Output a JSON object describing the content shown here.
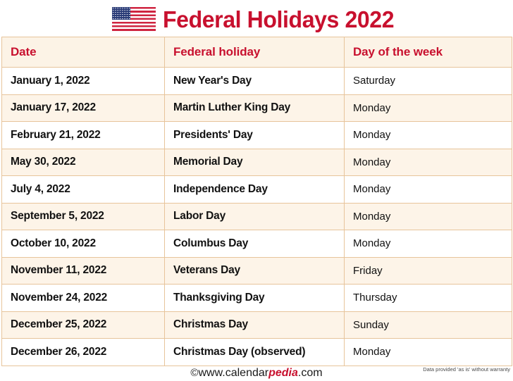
{
  "header": {
    "flag_icon": "us-flag-icon",
    "title": "Federal Holidays 2022"
  },
  "table": {
    "columns": [
      "Date",
      "Federal holiday",
      "Day of the week"
    ],
    "rows": [
      {
        "date": "January 1, 2022",
        "holiday": "New Year's Day",
        "day": "Saturday"
      },
      {
        "date": "January 17, 2022",
        "holiday": "Martin Luther King Day",
        "day": "Monday"
      },
      {
        "date": "February 21, 2022",
        "holiday": "Presidents' Day",
        "day": "Monday"
      },
      {
        "date": "May 30, 2022",
        "holiday": "Memorial Day",
        "day": "Monday"
      },
      {
        "date": "July 4, 2022",
        "holiday": "Independence Day",
        "day": "Monday"
      },
      {
        "date": "September 5, 2022",
        "holiday": "Labor Day",
        "day": "Monday"
      },
      {
        "date": "October 10, 2022",
        "holiday": "Columbus Day",
        "day": "Monday"
      },
      {
        "date": "November 11, 2022",
        "holiday": "Veterans Day",
        "day": "Friday"
      },
      {
        "date": "November 24, 2022",
        "holiday": "Thanksgiving Day",
        "day": "Thursday"
      },
      {
        "date": "December 25, 2022",
        "holiday": "Christmas Day",
        "day": "Sunday"
      },
      {
        "date": "December 26, 2022",
        "holiday": "Christmas Day (observed)",
        "day": "Monday"
      }
    ]
  },
  "footer": {
    "copyright_symbol": "©",
    "site_prefix": "www.calendar",
    "site_accent": "pedia",
    "site_suffix": ".com",
    "disclaimer": "Data provided 'as is' without warranty"
  },
  "colors": {
    "accent_red": "#c8102e",
    "row_cream": "#fdf4e8",
    "header_cream": "#fcf3e6",
    "border_tan": "#e7c49b"
  }
}
